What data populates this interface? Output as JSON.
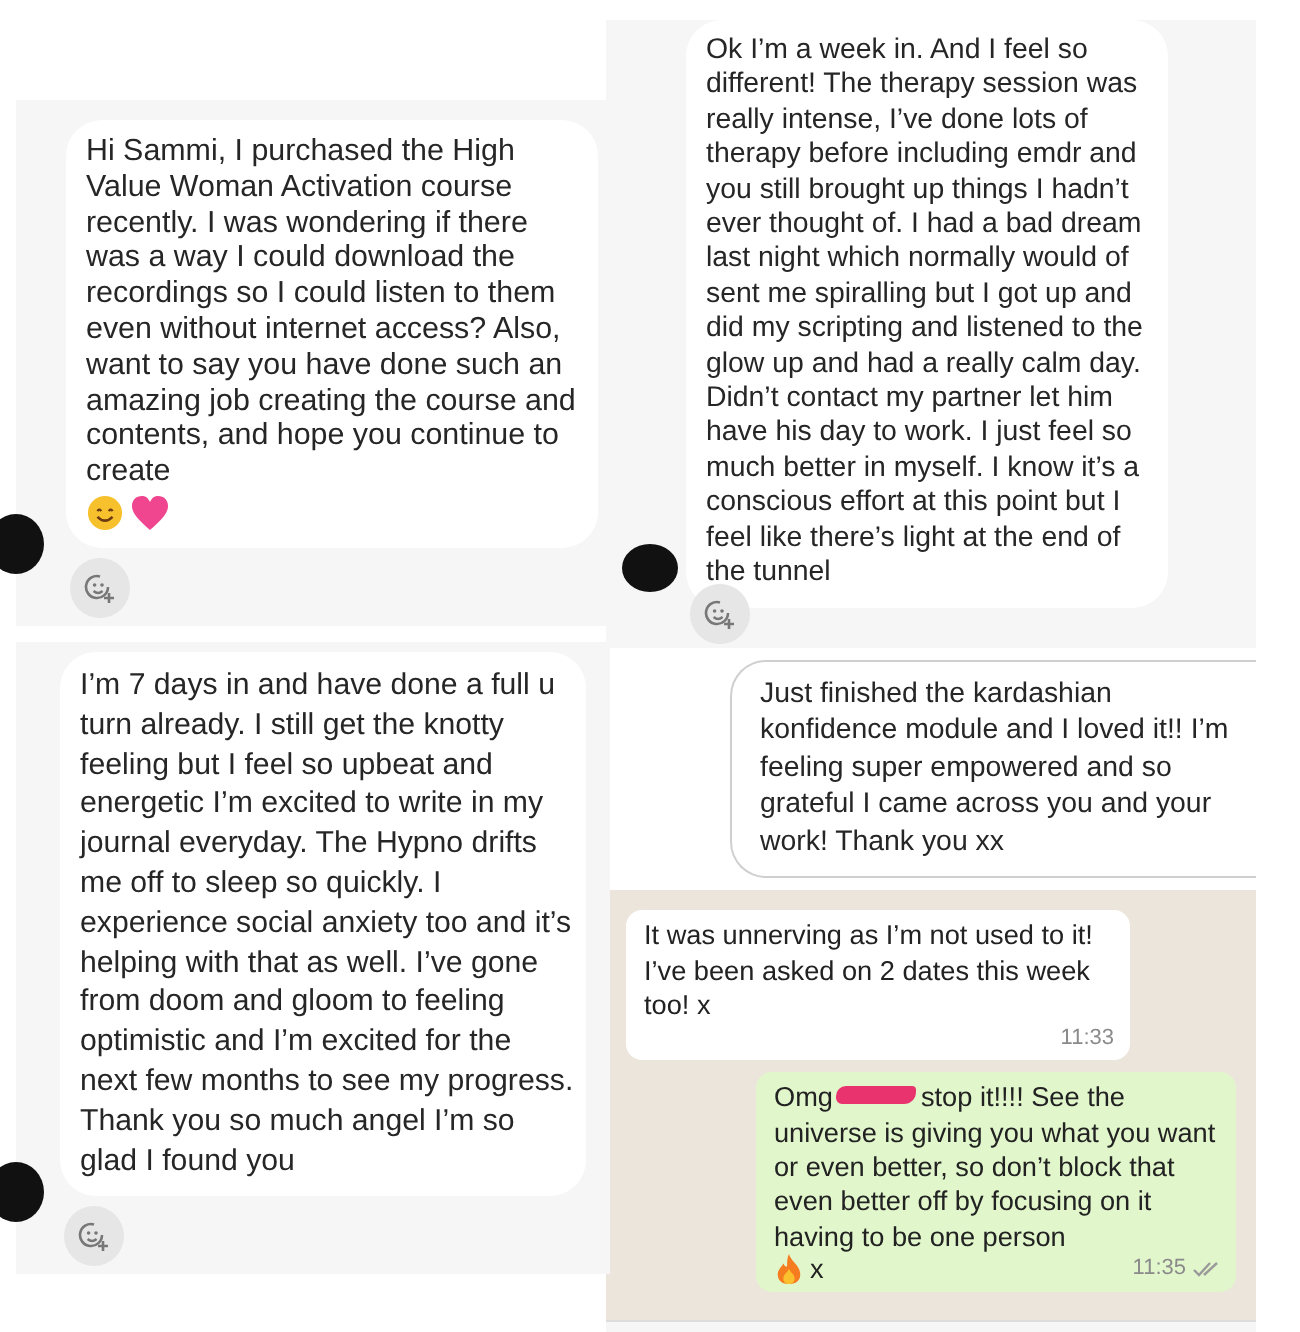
{
  "left_column": [
    {
      "kind": "dm",
      "messages": [
        {
          "text": "Hi Sammi, I purchased the High Value Woman Activation course recently. I was wondering if there was a way I could download the recordings so I could listen to them even without internet access? Also, want to say you have done such an amazing job creating the course and contents, and hope you continue to create",
          "emoji": [
            {
              "kind": "smile"
            },
            {
              "kind": "heart"
            }
          ]
        }
      ]
    },
    {
      "kind": "dm",
      "messages": [
        {
          "text": "I’m 7 days in and have done a full u turn already. I still get the knotty feeling but I feel so upbeat and energetic I’m excited to write in my journal everyday. The Hypno drifts me off to sleep so quickly. I experience social anxiety too and it’s helping with that as well. I’ve gone from doom and gloom to feeling optimistic and I’m excited for the next few months to see my progress. Thank you so much angel I’m so glad I found you"
        }
      ]
    }
  ],
  "right_column": [
    {
      "kind": "dm",
      "messages": [
        {
          "text": "Ok I’m a week in. And I feel so different! The therapy session was really intense, I’ve done lots of therapy before including emdr and you still brought up things I hadn’t ever thought of. I had a bad dream last night which normally would of sent me spiralling but I got up and did my scripting and listened to the glow up and had a really calm day. Didn’t contact my partner let him have his day to work. I just feel so much better in myself. I know it’s a conscious effort at this point but I feel like there’s light at the end of the tunnel"
        }
      ]
    },
    {
      "kind": "outlined",
      "messages": [
        {
          "text": "Just finished the kardashian konfidence module and I loved it!! I’m feeling super empowered and so grateful I came across you and your work! Thank you xx"
        }
      ]
    },
    {
      "kind": "whatsapp",
      "messages": [
        {
          "kind": "incoming",
          "text": "It was unnerving as I’m not used to it! I’ve been asked on 2 dates this week too! x",
          "time": "11:33"
        },
        {
          "kind": "outgoing",
          "lead": "Omg",
          "redacted": true,
          "text": "stop it!!!! See the universe is giving you what you want or even better, so don’t block that even better off by focusing on it having to be one person",
          "emoji": [
            {
              "kind": "fire"
            }
          ],
          "tail": "x",
          "time": "11:35"
        }
      ]
    }
  ]
}
